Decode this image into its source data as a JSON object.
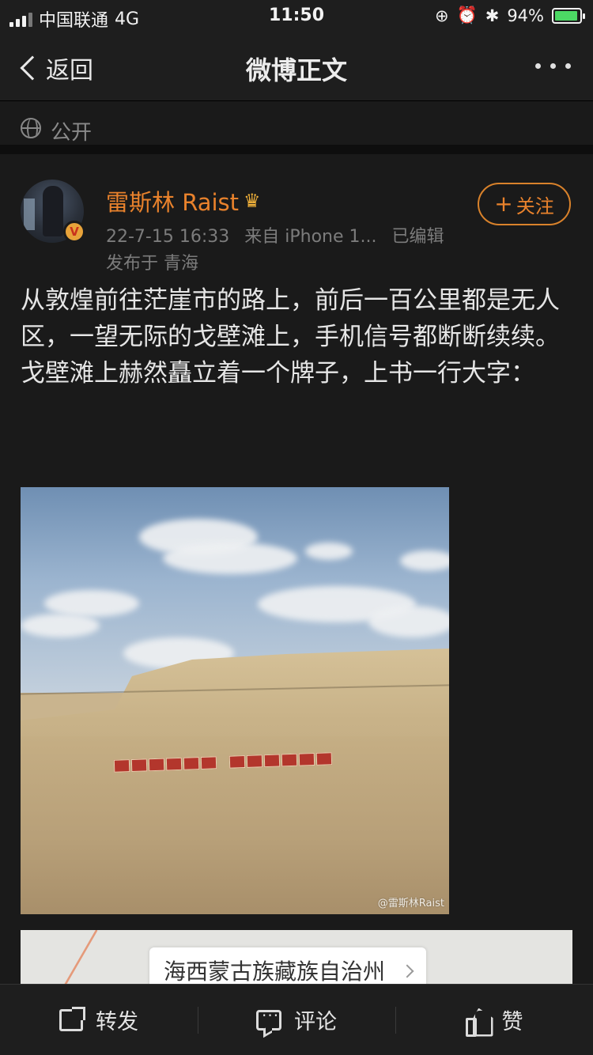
{
  "status_bar": {
    "carrier": "中国联通",
    "network": "4G",
    "time": "11:50",
    "battery": "94%",
    "battery_level": 0.94,
    "battery_color": "#4cd964"
  },
  "nav": {
    "back_label": "返回",
    "title": "微博正文"
  },
  "visibility": {
    "label": "公开",
    "icon": "globe-icon"
  },
  "post": {
    "author": {
      "name": "雷斯林 Raist",
      "badge_icon": "crown-icon",
      "verified": "V",
      "name_color": "#e9822c"
    },
    "timestamp": "22-7-15 16:33",
    "source": "来自 iPhone 1...",
    "edited": "已编辑",
    "location": "发布于 青海",
    "follow_label": "关注",
    "paragraphs": [
      "从敦煌前往茫崖市的路上，前后一百公里都是无人区，一望无际的戈壁滩上，手机信号都断断续续。",
      "戈壁滩上赫然矗立着一个牌子，上书一行大字："
    ],
    "photo": {
      "watermark": "@雷斯林Raist"
    },
    "map": {
      "place": "海西蒙古族藏族自治州"
    }
  },
  "toolbar": {
    "repost": "转发",
    "comment": "评论",
    "like": "赞"
  }
}
